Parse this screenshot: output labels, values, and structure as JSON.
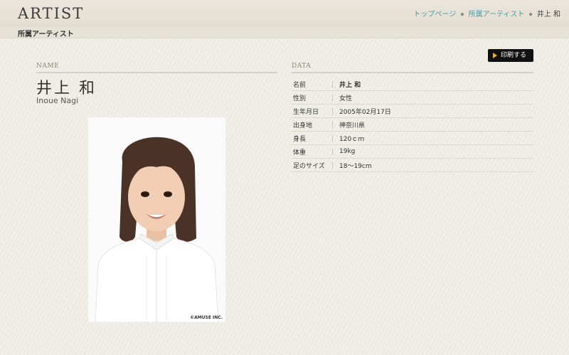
{
  "header": {
    "brand": "ARTIST",
    "subtitle": "所属アーティスト",
    "breadcrumb": [
      "トップページ",
      "所属アーティスト",
      "井上 和"
    ]
  },
  "actions": {
    "print_label": "印刷する"
  },
  "name_section": {
    "label": "NAME",
    "name_jp": "井上 和",
    "name_en": "Inoue Nagi",
    "photo_credit": "©AMUSE INC."
  },
  "data_section": {
    "label": "DATA",
    "rows": [
      {
        "key": "名前",
        "value": "井上 和"
      },
      {
        "key": "性別",
        "value": "女性"
      },
      {
        "key": "生年月日",
        "value": "2005年02月17日"
      },
      {
        "key": "出身地",
        "value": "神奈川県"
      },
      {
        "key": "身長",
        "value": "120ｃｍ"
      },
      {
        "key": "体重",
        "value": "19kg"
      },
      {
        "key": "足のサイズ",
        "value": "18〜19cm"
      }
    ]
  }
}
